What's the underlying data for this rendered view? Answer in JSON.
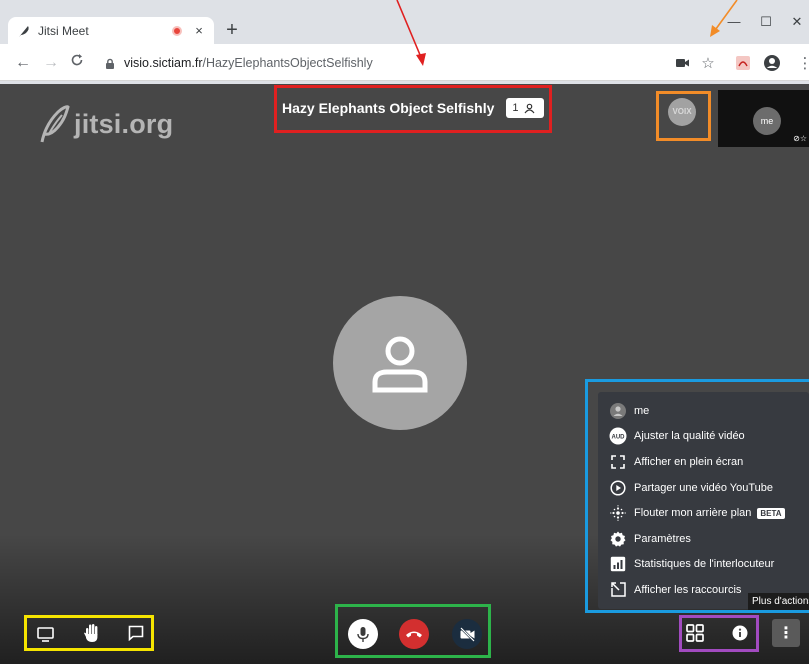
{
  "browser": {
    "tab_title": "Jitsi Meet",
    "tab_close": "×",
    "new_tab": "+",
    "url_host": "visio.sictiam.fr",
    "url_path": "/HazyElephantsObjectSelfishly",
    "window_controls": [
      "—",
      "☐",
      "✕"
    ],
    "icons": [
      "feather-icon",
      "record-dot-icon",
      "back-icon",
      "forward-icon",
      "reload-icon",
      "lock-icon",
      "camera-icon",
      "star-icon",
      "pdf-extension-icon",
      "account-icon",
      "kebab-icon"
    ]
  },
  "meeting": {
    "watermark": "jitsi.org",
    "subject": "Hazy Elephants Object Selfishly",
    "participant_count": "1",
    "remote_thumb_label": "VOIX",
    "self_thumb_label": "me",
    "self_status": "⊘☆",
    "background_color": "#474747"
  },
  "context_menu": {
    "items": [
      {
        "label": "me",
        "icon": "user-avatar-icon"
      },
      {
        "label": "Ajuster la qualité vidéo",
        "icon": "aud-icon",
        "icon_text": "AUD"
      },
      {
        "label": "Afficher en plein écran",
        "icon": "fullscreen-icon"
      },
      {
        "label": "Partager une vidéo YouTube",
        "icon": "play-circle-icon"
      },
      {
        "label": "Flouter mon arrière plan",
        "icon": "blur-icon",
        "badge": "BETA"
      },
      {
        "label": "Paramètres",
        "icon": "gear-icon"
      },
      {
        "label": "Statistiques de l'interlocuteur",
        "icon": "stats-icon"
      },
      {
        "label": "Afficher les raccourcis",
        "icon": "shortcut-icon"
      }
    ],
    "tooltip": "Plus d'actions"
  },
  "toolbar": {
    "left": [
      "screen-share-icon",
      "raise-hand-icon",
      "chat-icon"
    ],
    "center": [
      "microphone-button",
      "hangup-button",
      "camera-off-button"
    ],
    "right": [
      "tile-view-icon",
      "info-icon",
      "more-actions-icon"
    ],
    "more_label": "⋮"
  },
  "annotations": {
    "colors": {
      "red": "#e02020",
      "orange": "#f28c28",
      "blue": "#1a9be0",
      "yellow": "#f5e400",
      "green": "#2db34a",
      "purple": "#a24bc0"
    }
  }
}
